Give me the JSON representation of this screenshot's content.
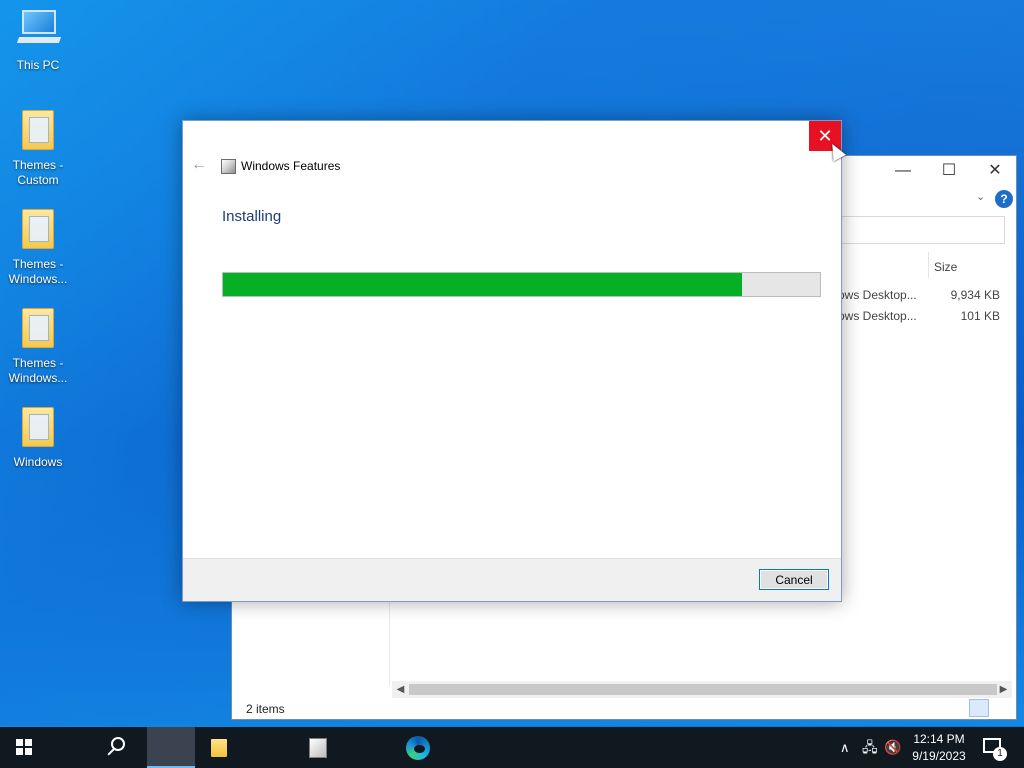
{
  "desktop": {
    "icons": [
      {
        "label": "This PC"
      },
      {
        "label": "Themes - Custom"
      },
      {
        "label": "Themes - Windows..."
      },
      {
        "label": "Themes - Windows..."
      },
      {
        "label": "Windows"
      }
    ]
  },
  "explorer": {
    "minimize": "—",
    "maximize": "☐",
    "close": "✕",
    "help": "?",
    "column_size": "Size",
    "rows": [
      {
        "name": "ows Desktop...",
        "size": "9,934 KB"
      },
      {
        "name": "ows Desktop...",
        "size": "101 KB"
      }
    ],
    "status": "2 items"
  },
  "dialog": {
    "title": "Windows Features",
    "heading": "Installing",
    "progress": 0.87,
    "cancel_label": "Cancel",
    "close_glyph": "✕",
    "back_glyph": "←"
  },
  "taskbar": {
    "time": "12:14 PM",
    "date": "9/19/2023",
    "notification_count": "1",
    "tray_up": "∧"
  }
}
